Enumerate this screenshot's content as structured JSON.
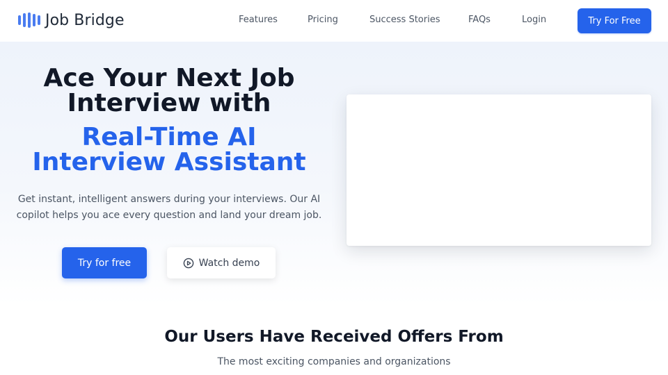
{
  "header": {
    "logo_text": "Job Bridge",
    "nav": [
      "Features",
      "Pricing",
      "Success Stories",
      "FAQs",
      "Login"
    ],
    "cta_label": "Try For Free"
  },
  "hero": {
    "title_lines": [
      "Ace Your Next Job",
      "Interview with"
    ],
    "accent_lines": [
      "Real-Time AI",
      "Interview Assistant"
    ],
    "subtitle_lines": [
      "Get instant, intelligent answers during your interviews. Our AI",
      "copilot helps you ace every question and land your dream job."
    ],
    "primary_button": "Try for free",
    "secondary_button": "Watch demo"
  },
  "offers": {
    "title": "Our Users Have Received Offers From",
    "subtitle": "The most exciting companies and organizations"
  },
  "colors": {
    "accent": "#2563eb",
    "heading": "#111827",
    "body_text": "#4b5563"
  },
  "icons": {
    "logo": "bar-chart-logo-icon",
    "demo": "play-circle-icon"
  }
}
